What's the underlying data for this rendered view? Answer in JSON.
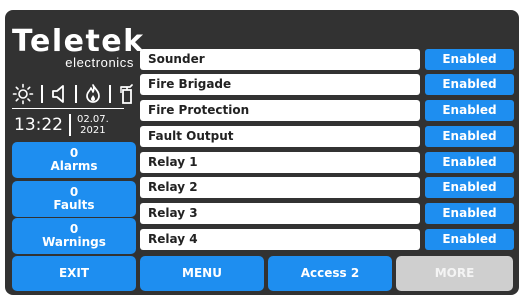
{
  "brand": {
    "name": "Teletek",
    "tagline": "electronics"
  },
  "status_icons": [
    "sun-icon",
    "speaker-icon",
    "flame-icon",
    "fire-extinguisher-icon"
  ],
  "clock": {
    "time": "13:22",
    "date_day_month": "02.07.",
    "date_year": "2021"
  },
  "counters": [
    {
      "count": "0",
      "label": "Alarms"
    },
    {
      "count": "0",
      "label": "Faults"
    },
    {
      "count": "0",
      "label": "Warnings"
    }
  ],
  "outputs": [
    {
      "label": "Sounder",
      "status": "Enabled"
    },
    {
      "label": "Fire Brigade",
      "status": "Enabled"
    },
    {
      "label": "Fire Protection",
      "status": "Enabled"
    },
    {
      "label": "Fault Output",
      "status": "Enabled"
    },
    {
      "label": "Relay 1",
      "status": "Enabled"
    },
    {
      "label": "Relay 2",
      "status": "Enabled"
    },
    {
      "label": "Relay 3",
      "status": "Enabled"
    },
    {
      "label": "Relay 4",
      "status": "Enabled"
    }
  ],
  "nav": {
    "exit_label": "EXIT",
    "menu_label": "MENU",
    "access_label": "Access 2",
    "more_label": "MORE"
  },
  "colors": {
    "panel": "#323232",
    "accent": "#1e8ef0",
    "disabled": "#cfcfcf"
  }
}
